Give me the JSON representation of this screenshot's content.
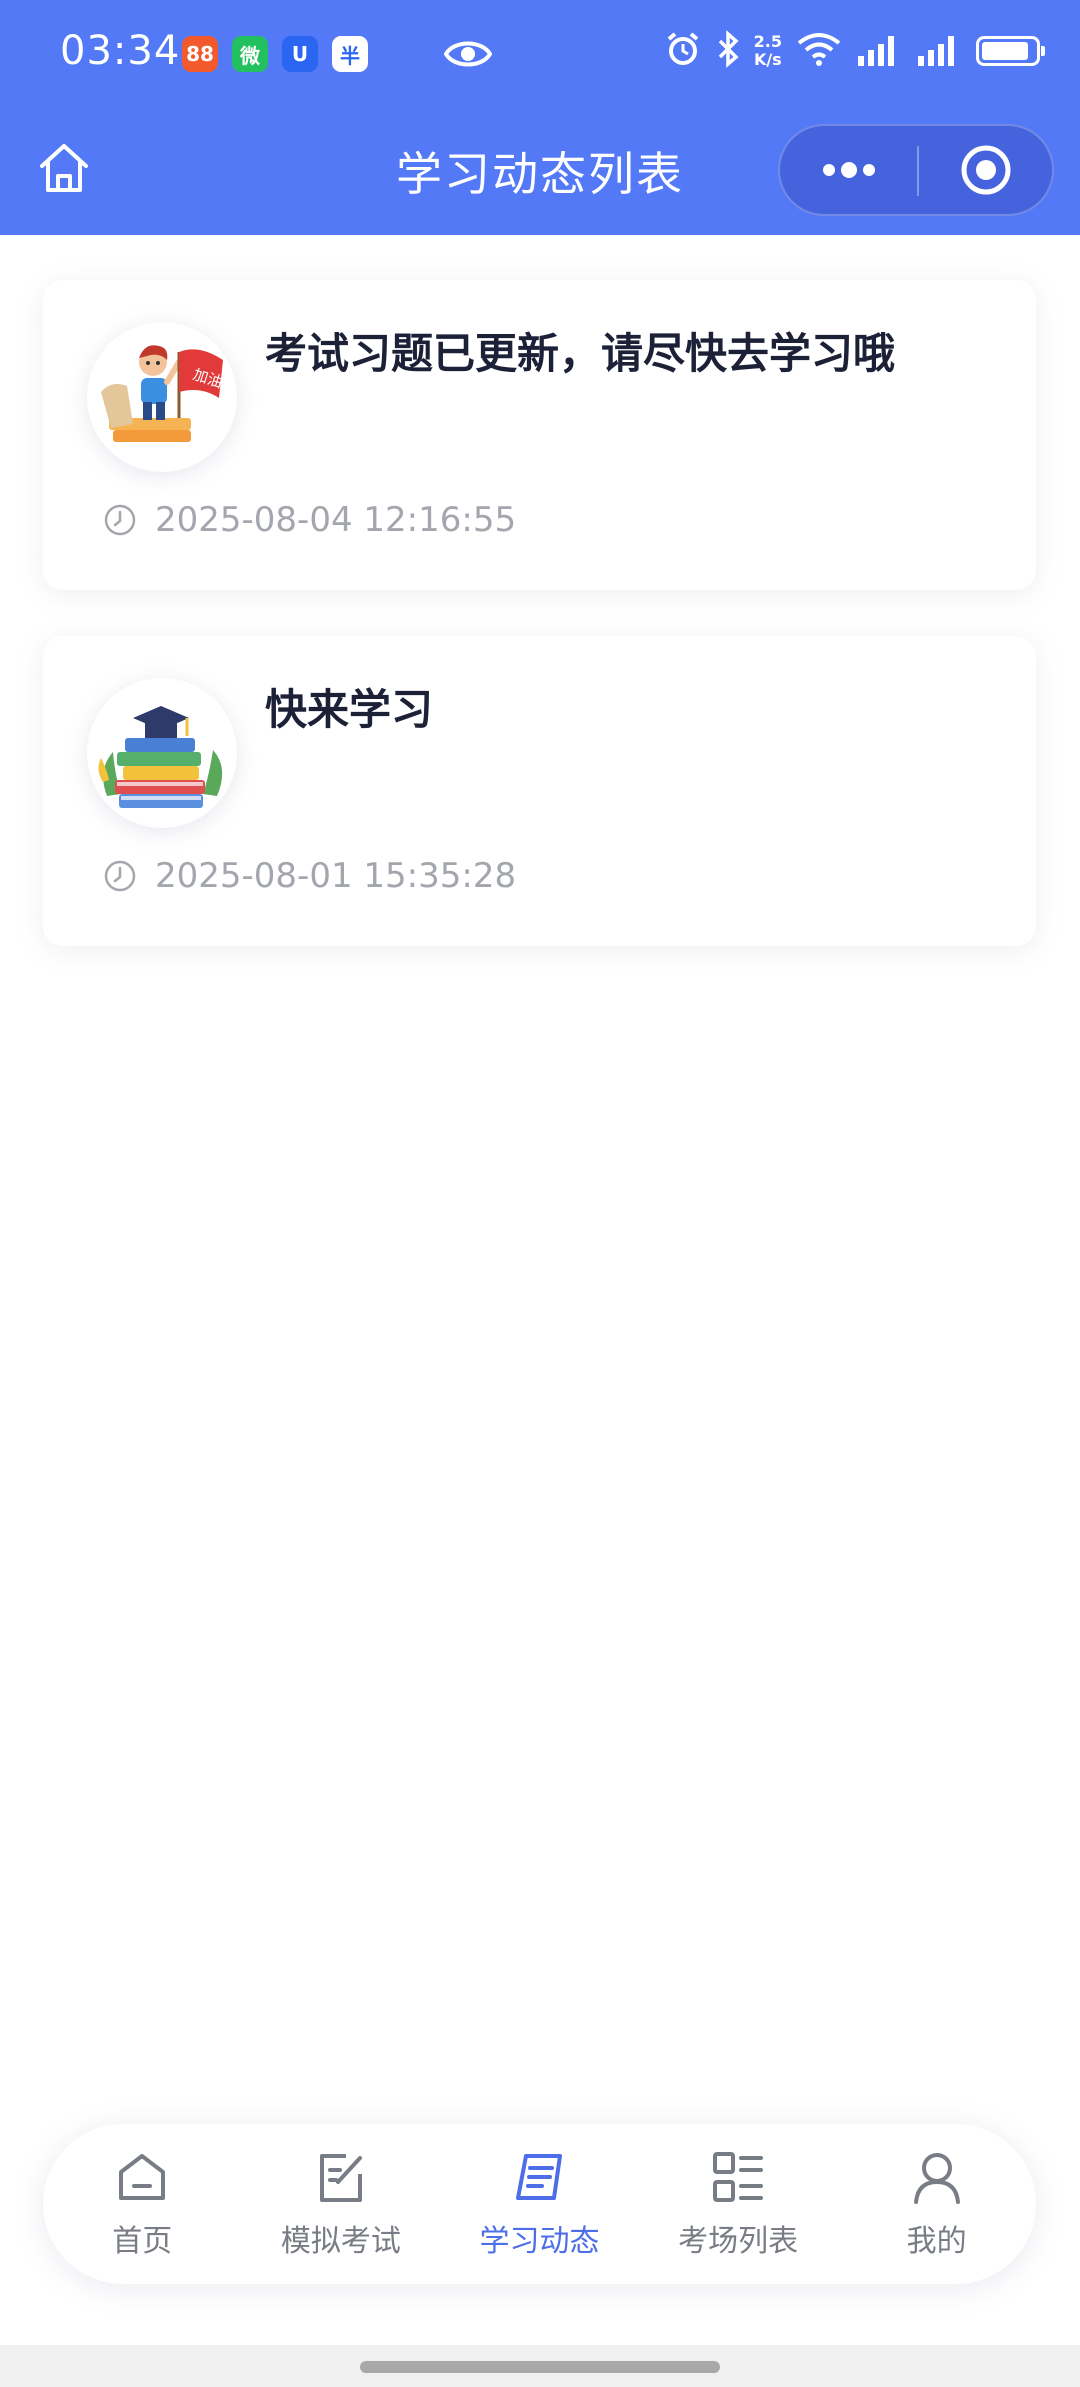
{
  "status_bar": {
    "time": "03:34",
    "apps": [
      "88",
      "微",
      "U",
      "半"
    ],
    "network_speed_value": "2.5",
    "network_speed_unit": "K/s",
    "battery_level": 0.9
  },
  "nav": {
    "title": "学习动态列表",
    "home_icon": "home-icon",
    "more_icon": "more-icon",
    "target_icon": "target-icon"
  },
  "cards": [
    {
      "title": "考试习题已更新，请尽快去学习哦",
      "time": "2025-08-04 12:16:55",
      "avatar": "cheering-boy-flag-illustration",
      "avatar_flag_text": "加油"
    },
    {
      "title": "快来学习",
      "time": "2025-08-01 15:35:28",
      "avatar": "book-stack-graduation-cap-illustration"
    }
  ],
  "tabbar": {
    "items": [
      {
        "label": "首页",
        "icon": "home-tab-icon",
        "active": false
      },
      {
        "label": "模拟考试",
        "icon": "edit-note-icon",
        "active": false
      },
      {
        "label": "学习动态",
        "icon": "news-icon",
        "active": true
      },
      {
        "label": "考场列表",
        "icon": "list-grid-icon",
        "active": false
      },
      {
        "label": "我的",
        "icon": "user-icon",
        "active": false
      }
    ],
    "active_color": "#4d6ee8",
    "inactive_color": "#787c85"
  },
  "colors": {
    "header": "#5379f7",
    "title_text": "#1c2138",
    "time_text": "#a3a6ad"
  }
}
